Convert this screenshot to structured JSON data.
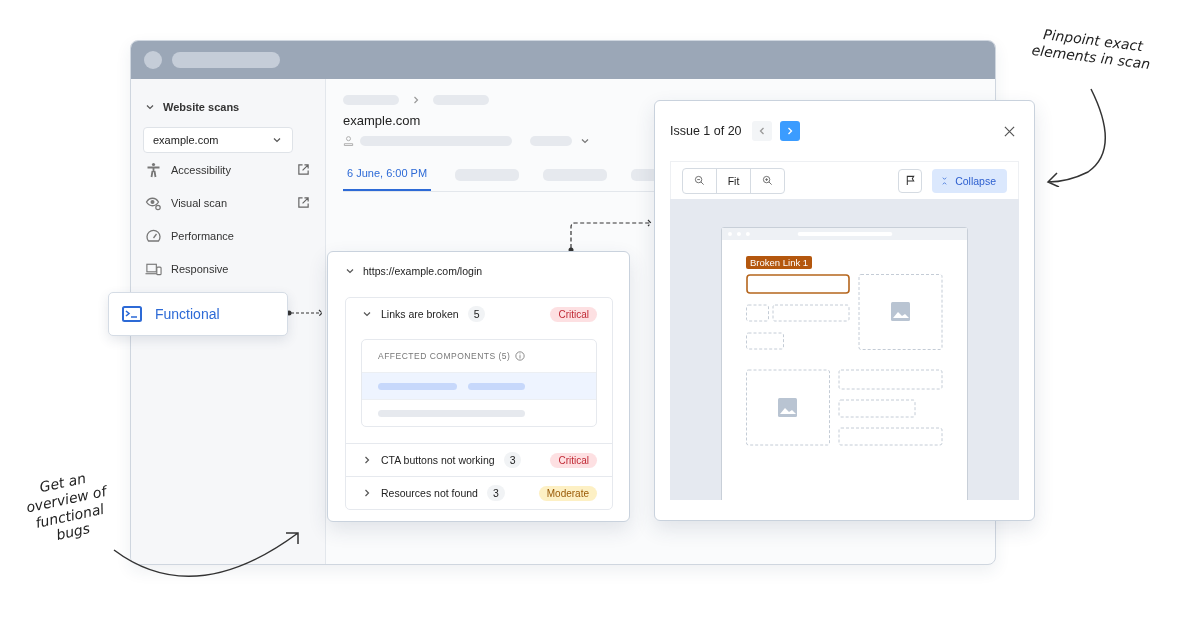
{
  "window": {
    "sidebar": {
      "section_title": "Website scans",
      "site_select": "example.com",
      "items": [
        {
          "label": "Accessibility",
          "kind": "person",
          "external": true
        },
        {
          "label": "Visual scan",
          "kind": "eye",
          "external": true
        },
        {
          "label": "Performance",
          "kind": "gauge",
          "external": false
        },
        {
          "label": "Responsive",
          "kind": "devices",
          "external": false
        }
      ]
    },
    "main": {
      "title": "example.com",
      "tabs": [
        {
          "label": "6 June, 6:00 PM",
          "selected": true
        }
      ]
    }
  },
  "functional_card": {
    "label": "Functional"
  },
  "issues_panel": {
    "url": "https://example.com/login",
    "issues": [
      {
        "title": "Links are broken",
        "count": "5",
        "severity": {
          "label": "Critical",
          "kind": "critical"
        },
        "expanded": true,
        "components_title": "AFFECTED COMPONENTS (5)"
      },
      {
        "title": "CTA buttons not working",
        "count": "3",
        "severity": {
          "label": "Critical",
          "kind": "critical"
        },
        "expanded": false
      },
      {
        "title": "Resources not found",
        "count": "3",
        "severity": {
          "label": "Moderate",
          "kind": "moderate"
        },
        "expanded": false
      }
    ]
  },
  "issue_viewer": {
    "title": "Issue 1 of 20",
    "prev_disabled": true,
    "next_disabled": false,
    "fit": "Fit",
    "collapse": "Collapse",
    "highlight_label": "Broken Link 1"
  },
  "annotations": [
    {
      "text": "Get an overview of functional bugs",
      "kind": "left"
    },
    {
      "text": "Pinpoint exact elements in scan",
      "kind": "right"
    }
  ]
}
